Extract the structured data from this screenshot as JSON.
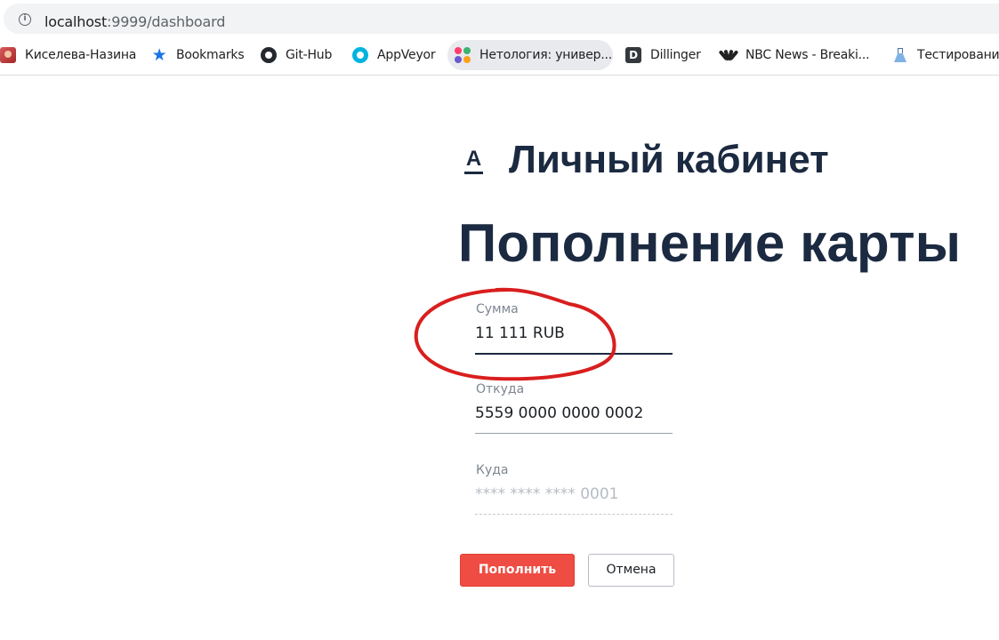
{
  "browser": {
    "url_host": "localhost",
    "url_path": ":9999/dashboard",
    "bookmarks": [
      {
        "label": "Киселева-Назина",
        "icon": "avatar-icon"
      },
      {
        "label": "Bookmarks",
        "icon": "star-icon"
      },
      {
        "label": "Git-Hub",
        "icon": "github-icon"
      },
      {
        "label": "AppVeyor",
        "icon": "appveyor-icon"
      },
      {
        "label": "Нетология: универ...",
        "icon": "netology-icon"
      },
      {
        "label": "Dillinger",
        "icon": "dillinger-icon",
        "glyph": "D"
      },
      {
        "label": "NBC News - Breaki...",
        "icon": "nbc-icon"
      },
      {
        "label": "Тестирование",
        "icon": "flask-icon"
      }
    ]
  },
  "page": {
    "logo": "А",
    "cabinet_title": "Личный кабинет",
    "heading": "Пополнение карты"
  },
  "form": {
    "amount": {
      "label": "Сумма",
      "value": "11 111 RUB"
    },
    "from": {
      "label": "Откуда",
      "value": "5559 0000 0000 0002"
    },
    "to": {
      "label": "Куда",
      "placeholder": "**** **** **** 0001"
    },
    "submit_label": "Пополнить",
    "cancel_label": "Отмена"
  },
  "colors": {
    "primary_button": "#ef4c43",
    "heading_text": "#1b2a41",
    "annotation_circle": "#d91e1e"
  }
}
